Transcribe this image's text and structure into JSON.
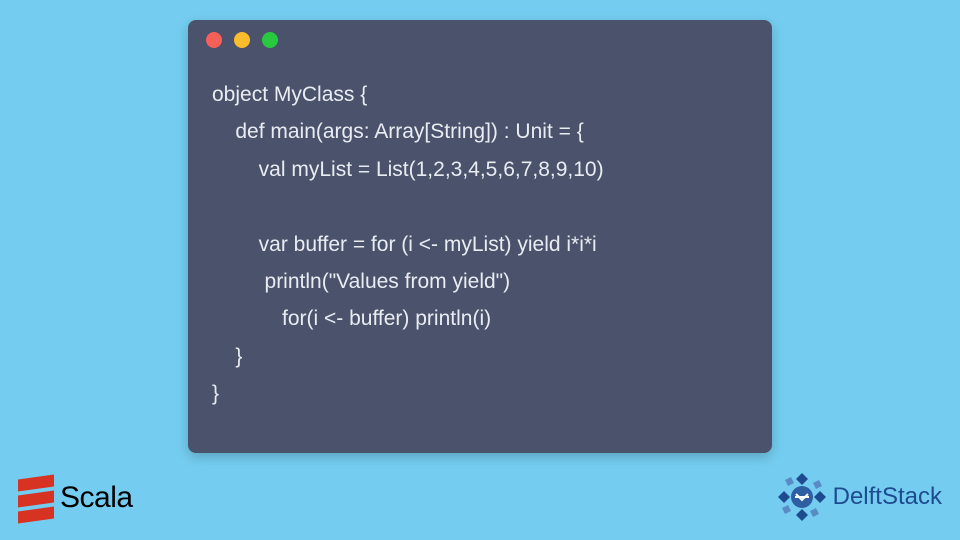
{
  "window": {
    "dots": [
      "red",
      "yellow",
      "green"
    ]
  },
  "code": {
    "lines": [
      "object MyClass {",
      "    def main(args: Array[String]) : Unit = {",
      "        val myList = List(1,2,3,4,5,6,7,8,9,10)",
      "",
      "        var buffer = for (i <- myList) yield i*i*i",
      "         println(\"Values from yield\")",
      "            for(i <- buffer) println(i)",
      "    }",
      "}"
    ]
  },
  "logos": {
    "scala": {
      "label": "Scala"
    },
    "delftstack": {
      "label": "DelftStack"
    }
  }
}
